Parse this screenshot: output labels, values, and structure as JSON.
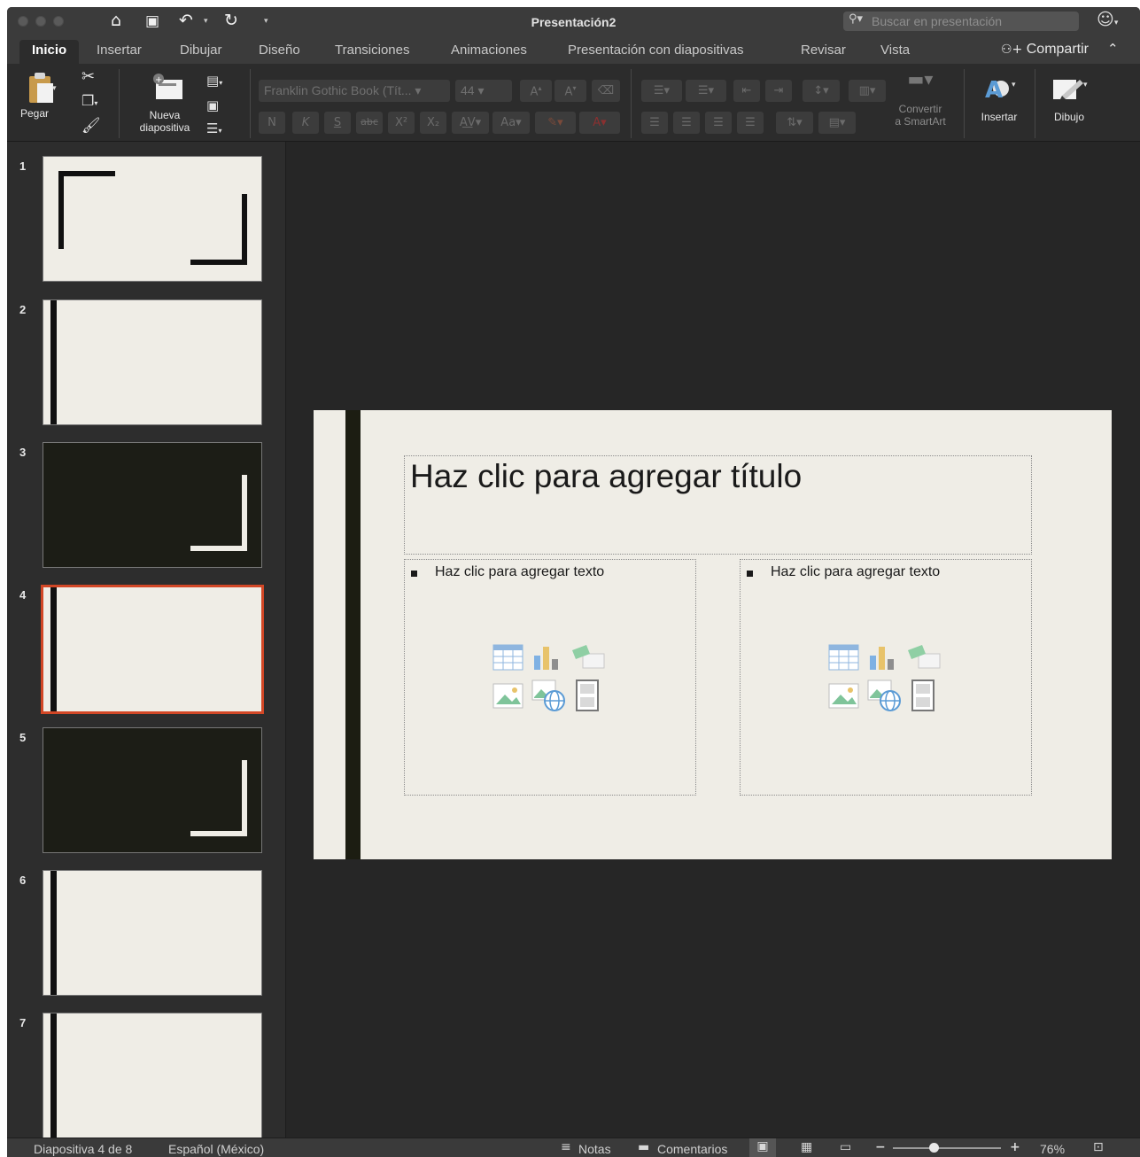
{
  "window": {
    "title": "Presentación2",
    "search_placeholder": "Buscar en presentación"
  },
  "tabs": [
    {
      "label": "Inicio",
      "active": true
    },
    {
      "label": "Insertar"
    },
    {
      "label": "Dibujar"
    },
    {
      "label": "Diseño"
    },
    {
      "label": "Transiciones"
    },
    {
      "label": "Animaciones"
    },
    {
      "label": "Presentación con diapositivas"
    },
    {
      "label": "Revisar"
    },
    {
      "label": "Vista"
    }
  ],
  "share_label": "Compartir",
  "ribbon": {
    "paste_label": "Pegar",
    "new_slide_label_1": "Nueva",
    "new_slide_label_2": "diapositiva",
    "font_name": "Franklin Gothic Book (Tít...",
    "font_size": "44",
    "bold": "N",
    "italic": "K",
    "underline": "S",
    "strike": "abc",
    "smartart_label_1": "Convertir",
    "smartart_label_2": "a SmartArt",
    "insert_label": "Insertar",
    "draw_label": "Dibujo"
  },
  "thumbnails": [
    {
      "number": "1",
      "style": "corners-light"
    },
    {
      "number": "2",
      "style": "bar-light"
    },
    {
      "number": "3",
      "style": "corner-dark"
    },
    {
      "number": "4",
      "style": "bar-light",
      "selected": true
    },
    {
      "number": "5",
      "style": "corner-dark"
    },
    {
      "number": "6",
      "style": "bar-light"
    },
    {
      "number": "7",
      "style": "bar-light"
    }
  ],
  "slide": {
    "title_placeholder": "Haz clic para agregar título",
    "left_text_placeholder": "Haz clic para agregar texto",
    "right_text_placeholder": "Haz clic para agregar texto",
    "background": "#efede6",
    "accent_bar": "#1c1d12"
  },
  "statusbar": {
    "slide_info": "Diapositiva 4 de 8",
    "language": "Español (México)",
    "notes": "Notas",
    "comments": "Comentarios",
    "zoom": "76%",
    "zoom_level_fraction": 0.38
  },
  "colors": {
    "accent": "#d24726",
    "window_bg": "#262626",
    "ribbon_bg": "#2c2c2c"
  }
}
